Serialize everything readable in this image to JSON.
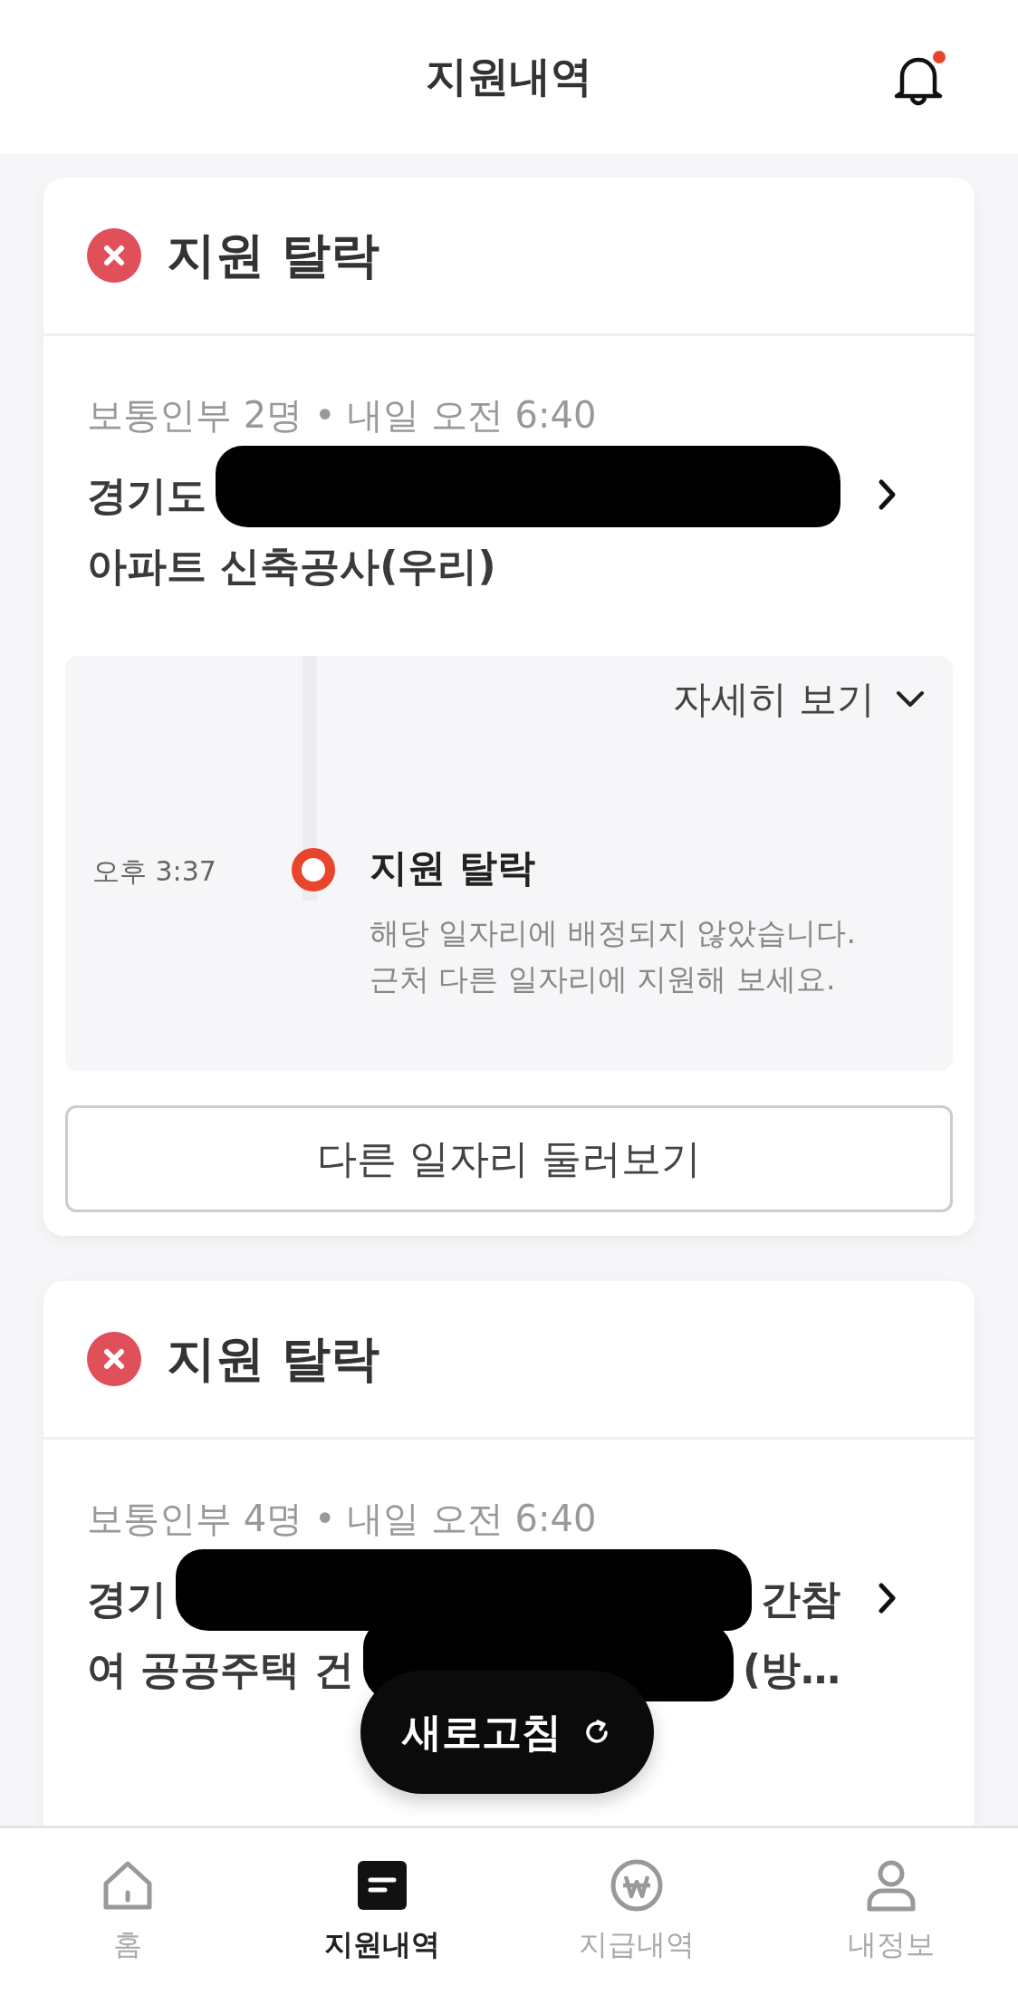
{
  "header": {
    "title": "지원내역",
    "has_unread": true
  },
  "applications": [
    {
      "kind": "rejected",
      "status_label": "지원 탈락",
      "meta": "보통인부 2명 • 내일 오전 6:40",
      "title_lines": [
        [
          {
            "kind": "text",
            "text": "경기도"
          },
          {
            "kind": "redacted"
          }
        ],
        [
          {
            "kind": "text",
            "text": "아파트 신축공사(우리)"
          }
        ]
      ],
      "details": {
        "toggle_label": "자세히 보기",
        "expanded": false,
        "events": [
          {
            "time": "오후 3:37",
            "title": "지원 탈락",
            "description": "해당 일자리에 배정되지 않았습니다.\n근처 다른 일자리에 지원해 보세요."
          }
        ]
      },
      "action": "다른 일자리 둘러보기"
    },
    {
      "kind": "rejected",
      "status_label": "지원 탈락",
      "meta": "보통인부 4명 • 내일 오전 6:40",
      "title_lines": [
        [
          {
            "kind": "text",
            "text": "경기"
          },
          {
            "kind": "redacted"
          },
          {
            "kind": "text",
            "text": "간참"
          }
        ],
        [
          {
            "kind": "text",
            "text": "여 공공주택 건"
          },
          {
            "kind": "redacted"
          },
          {
            "kind": "text",
            "text": "(방…"
          }
        ]
      ]
    }
  ],
  "refresh_button": "새로고침",
  "tabs": [
    {
      "kind": "home",
      "label": "홈",
      "selected": false
    },
    {
      "kind": "list",
      "label": "지원내역",
      "selected": true
    },
    {
      "kind": "won",
      "label": "지급내역",
      "selected": false
    },
    {
      "kind": "person",
      "label": "내정보",
      "selected": false
    }
  ]
}
